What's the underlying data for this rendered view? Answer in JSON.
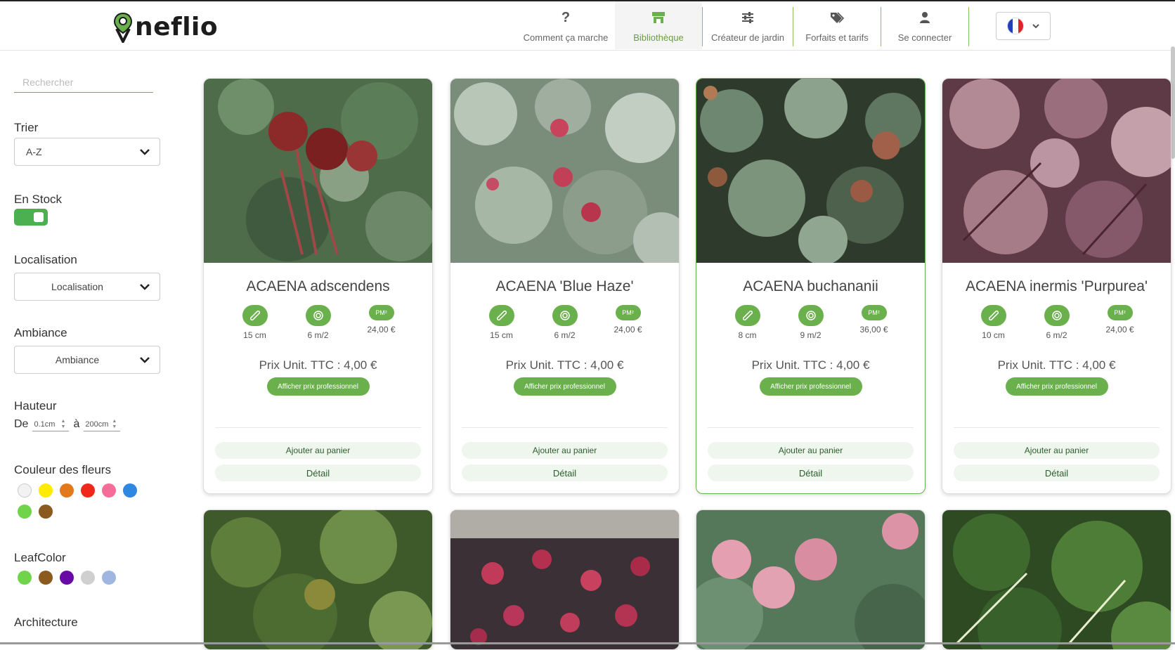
{
  "brand": {
    "logo_text": "neflio",
    "accent": "#6ab04c"
  },
  "nav": {
    "items": [
      {
        "label": "Comment ça marche",
        "icon": "question-icon"
      },
      {
        "label": "Bibliothèque",
        "icon": "shop-icon",
        "active": true
      },
      {
        "label": "Créateur de jardin",
        "icon": "sliders-icon"
      },
      {
        "label": "Forfaits et tarifs",
        "icon": "tags-icon"
      },
      {
        "label": "Se connecter",
        "icon": "user-icon"
      }
    ],
    "language": "fr"
  },
  "sidebar": {
    "search_placeholder": "Rechercher",
    "sort": {
      "label": "Trier",
      "value": "A-Z"
    },
    "stock": {
      "label": "En Stock",
      "on": true
    },
    "location": {
      "label": "Localisation",
      "value": "Localisation"
    },
    "ambiance": {
      "label": "Ambiance",
      "value": "Ambiance"
    },
    "height": {
      "label": "Hauteur",
      "from_label": "De",
      "from_value": "0.1cm",
      "to_label": "à",
      "to_value": "200cm"
    },
    "flower_color": {
      "label": "Couleur des fleurs",
      "colors": [
        "#f2f2f2",
        "#ffeb00",
        "#e27a1c",
        "#f0281c",
        "#f56d99",
        "#2e87e0",
        "#70d44a",
        "#8a5a1e"
      ]
    },
    "leaf_color": {
      "label": "LeafColor",
      "colors": [
        "#70d44a",
        "#8a5a1e",
        "#6a0aa6",
        "#cfcfcf",
        "#9fb6e0"
      ]
    },
    "architecture": {
      "label": "Architecture"
    }
  },
  "cards": [
    {
      "title": "ACAENA adscendens",
      "height": "15 cm",
      "density": "6 m/2",
      "pm_label": "PM²",
      "pm_price": "24,00 €",
      "price": "Prix Unit. TTC : 4,00 €",
      "pro_btn": "Afficher prix professionnel",
      "add_btn": "Ajouter au panier",
      "detail_btn": "Détail"
    },
    {
      "title": "ACAENA 'Blue Haze'",
      "height": "15 cm",
      "density": "6 m/2",
      "pm_label": "PM²",
      "pm_price": "24,00 €",
      "price": "Prix Unit. TTC : 4,00 €",
      "pro_btn": "Afficher prix professionnel",
      "add_btn": "Ajouter au panier",
      "detail_btn": "Détail"
    },
    {
      "title": "ACAENA buchananii",
      "height": "8 cm",
      "density": "9 m/2",
      "pm_label": "PM²",
      "pm_price": "36,00 €",
      "price": "Prix Unit. TTC : 4,00 €",
      "pro_btn": "Afficher prix professionnel",
      "add_btn": "Ajouter au panier",
      "detail_btn": "Détail"
    },
    {
      "title": "ACAENA inermis 'Purpurea'",
      "height": "10 cm",
      "density": "6 m/2",
      "pm_label": "PM²",
      "pm_price": "24,00 €",
      "price": "Prix Unit. TTC : 4,00 €",
      "pro_btn": "Afficher prix professionnel",
      "add_btn": "Ajouter au panier",
      "detail_btn": "Détail"
    }
  ]
}
